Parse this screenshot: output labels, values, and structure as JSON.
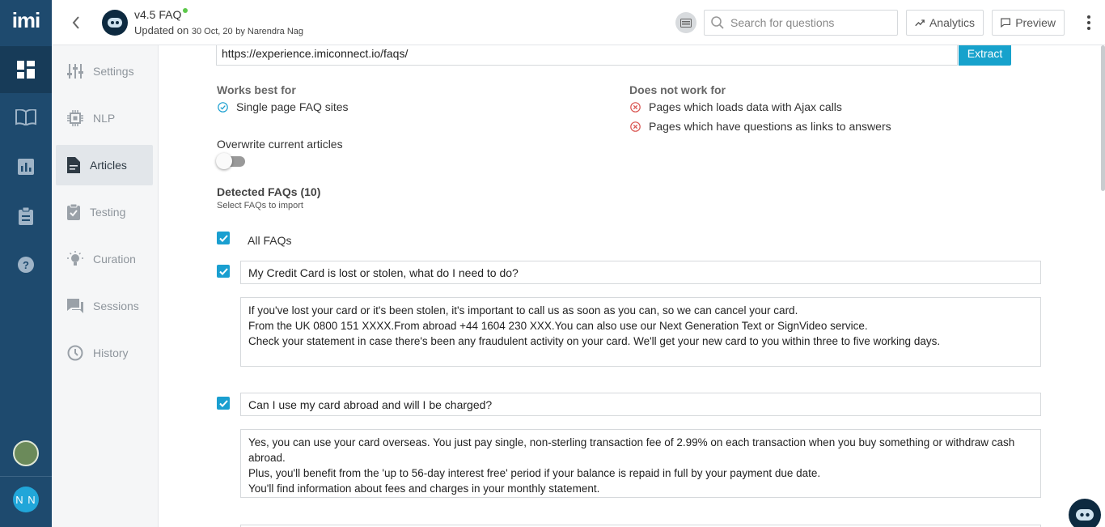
{
  "app": {
    "logo": "imi"
  },
  "rail": {
    "items": [
      {
        "icon": "dashboard-icon",
        "active": true
      },
      {
        "icon": "book-icon",
        "active": false
      },
      {
        "icon": "bar-chart-icon",
        "active": false
      },
      {
        "icon": "clipboard-icon",
        "active": false
      },
      {
        "icon": "help-icon",
        "active": false
      }
    ],
    "user_initials": "N N"
  },
  "header": {
    "bot_name": "v4.5 FAQ",
    "updated_prefix": "Updated on",
    "updated_date": "30 Oct, 20",
    "updated_by": "by Narendra Nag",
    "search_placeholder": "Search for questions",
    "analytics_label": "Analytics",
    "preview_label": "Preview"
  },
  "subnav": {
    "items": [
      {
        "label": "Settings",
        "icon": "sliders-icon"
      },
      {
        "label": "NLP",
        "icon": "chip-icon"
      },
      {
        "label": "Articles",
        "icon": "document-icon",
        "active": true
      },
      {
        "label": "Testing",
        "icon": "clipboard-check-icon"
      },
      {
        "label": "Curation",
        "icon": "lightbulb-icon"
      },
      {
        "label": "Sessions",
        "icon": "chat-icon"
      },
      {
        "label": "History",
        "icon": "clock-icon"
      }
    ]
  },
  "extract": {
    "url_value": "https://experience.imiconnect.io/faqs/",
    "button_label": "Extract"
  },
  "works_best": {
    "title": "Works best for",
    "items": [
      "Single page FAQ sites"
    ]
  },
  "not_work": {
    "title": "Does not work for",
    "items": [
      "Pages which loads data with Ajax calls",
      "Pages which have questions as links to answers"
    ]
  },
  "overwrite": {
    "label": "Overwrite current articles",
    "enabled": false
  },
  "detected": {
    "title": "Detected FAQs (10)",
    "subtitle": "Select FAQs to import",
    "all_label": "All FAQs",
    "faqs": [
      {
        "question": "My Credit Card is lost or stolen, what do I need to do?",
        "answer_lines": [
          "If you've lost your card or it's been stolen, it's important to call us as soon as you can, so we can cancel your card.",
          "From the UK 0800 151 XXXX.From abroad +44 1604 230 XXX.You can also use our Next Generation Text or SignVideo service.",
          "Check your statement in case there's been any fraudulent activity on your card. We'll get your new card to you within three to five working days."
        ],
        "checked": true
      },
      {
        "question": "Can I use my card abroad and will I be charged?",
        "answer_lines": [
          "Yes, you can use your card overseas. You just pay single, non-sterling transaction fee of 2.99% on each transaction when you buy something or withdraw cash abroad.",
          "Plus, you'll benefit from the 'up to 56-day interest free' period if your balance is repaid in full by your payment due date.",
          "You'll find information about fees and charges in your monthly statement."
        ],
        "checked": true
      }
    ]
  },
  "colors": {
    "rail": "#1e4a6e",
    "accent": "#1a9fd0",
    "status_online": "#5cc84a"
  }
}
